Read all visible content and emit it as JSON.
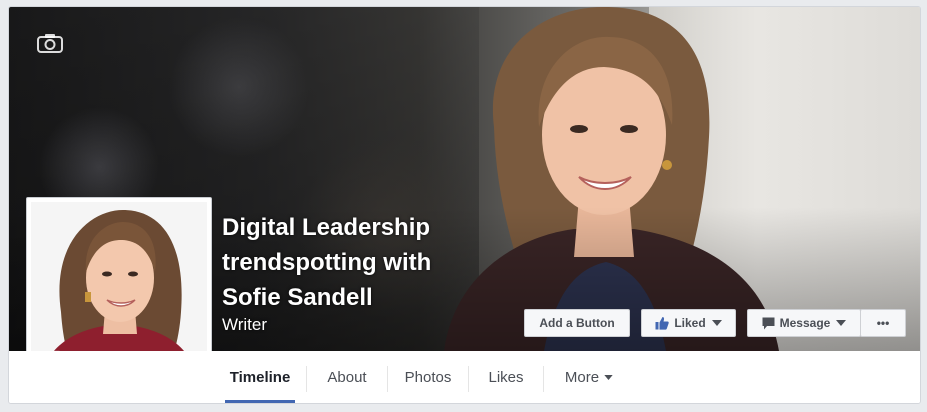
{
  "page": {
    "title": "Digital Leadership trendspotting with Sofie Sandell",
    "title_lines": [
      "Digital Leadership",
      "trendspotting with",
      "Sofie Sandell"
    ],
    "category": "Writer"
  },
  "actions": {
    "add_button_label": "Add a Button",
    "liked_label": "Liked",
    "message_label": "Message",
    "more_label": "•••"
  },
  "tabs": [
    {
      "label": "Timeline",
      "active": true
    },
    {
      "label": "About",
      "active": false
    },
    {
      "label": "Photos",
      "active": false
    },
    {
      "label": "Likes",
      "active": false
    },
    {
      "label": "More",
      "active": false
    }
  ],
  "icons": {
    "cover_camera": "camera-icon",
    "profile_camera": "camera-icon",
    "liked": "thumbs-up-icon",
    "message": "message-bubble-icon",
    "dropdown": "chevron-down-icon"
  },
  "colors": {
    "accent": "#4267b2",
    "button_bg": "#f6f7f9",
    "button_text": "#4b4f56",
    "liked_icon": "#4267b2"
  }
}
